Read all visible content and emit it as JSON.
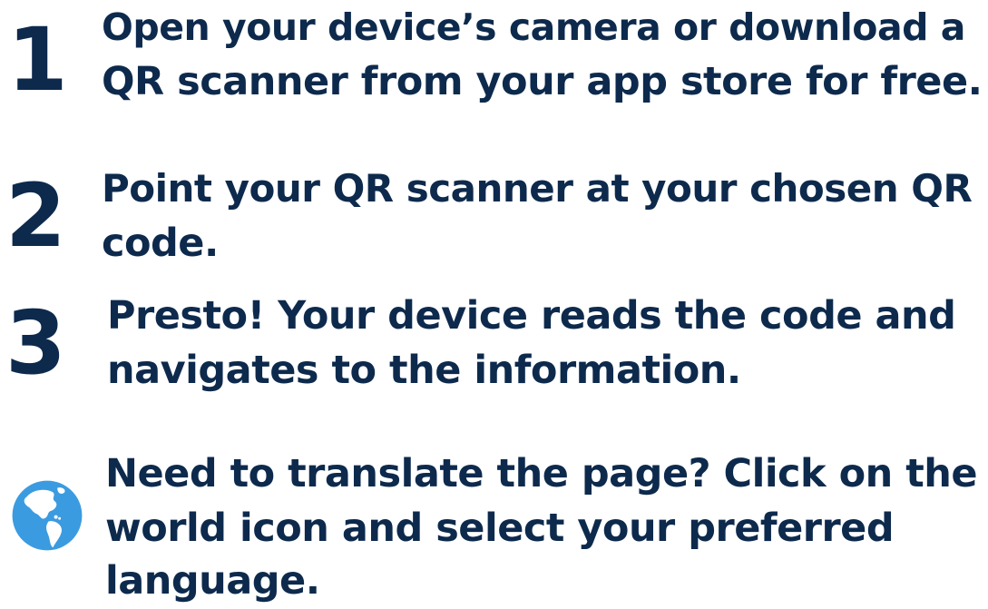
{
  "steps": [
    {
      "number": "1",
      "lines": [
        "Open your device’s camera or download a",
        "QR scanner from your app store for free."
      ]
    },
    {
      "number": "2",
      "lines": [
        "Point your QR scanner at your chosen QR",
        "code."
      ]
    },
    {
      "number": "3",
      "lines": [
        "Presto! Your device reads the code and",
        "navigates to the information."
      ]
    }
  ],
  "translate": {
    "icon": "globe-icon",
    "lines": [
      "Need to translate the page? Click on the",
      "world icon and select your preferred",
      "language."
    ]
  },
  "colors": {
    "text": "#0d2a4d",
    "globe_ocean": "#3b9be0",
    "globe_land": "#ffffff"
  }
}
